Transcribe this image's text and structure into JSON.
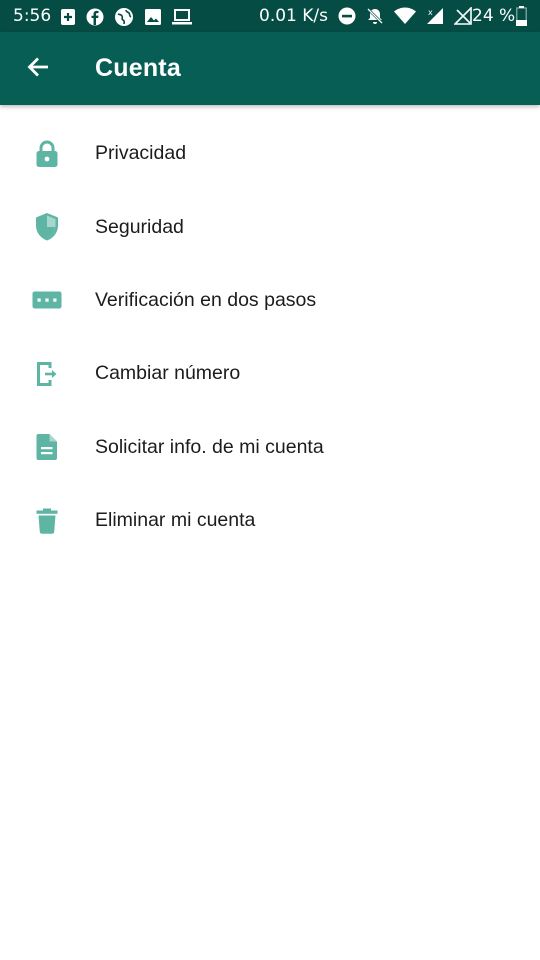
{
  "status_bar": {
    "time": "5:56",
    "speed": "0.01 K/s",
    "battery_pct": "24 %",
    "left_icons": [
      "add-box-icon",
      "facebook-icon",
      "globe-icon",
      "image-icon",
      "laptop-icon"
    ],
    "right_icons": [
      "dnd-icon",
      "notifications-off-icon",
      "wifi-icon",
      "signal-icon",
      "no-sim-icon",
      "battery-icon"
    ]
  },
  "app_bar": {
    "title": "Cuenta",
    "back_icon": "arrow-back-icon"
  },
  "menu": {
    "items": [
      {
        "label": "Privacidad",
        "icon": "lock-icon"
      },
      {
        "label": "Seguridad",
        "icon": "shield-icon"
      },
      {
        "label": "Verificación en dos pasos",
        "icon": "password-dots-icon"
      },
      {
        "label": "Cambiar número",
        "icon": "phone-change-icon"
      },
      {
        "label": "Solicitar info. de mi cuenta",
        "icon": "document-icon"
      },
      {
        "label": "Eliminar mi cuenta",
        "icon": "trash-icon"
      }
    ]
  },
  "colors": {
    "status_bar": "#054d44",
    "app_bar": "#075e54",
    "icon": "#5fb5a3",
    "text": "#1c1c1c"
  }
}
